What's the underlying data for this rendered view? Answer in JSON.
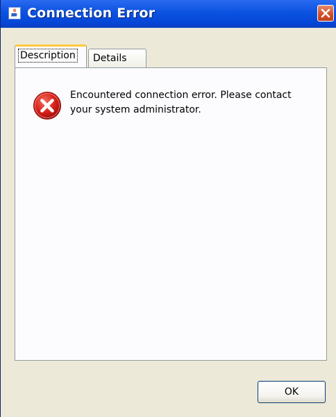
{
  "window": {
    "title": "Connection Error",
    "icon": "java-cup-icon",
    "close_icon": "close-icon"
  },
  "tabs": [
    {
      "label": "Description",
      "active": true
    },
    {
      "label": "Details",
      "active": false
    }
  ],
  "content": {
    "icon": "error-icon",
    "message": "Encountered connection error. Please contact your system administrator."
  },
  "buttons": {
    "ok_label": "OK"
  },
  "colors": {
    "titlebar": "#0a52e0",
    "close_button": "#d4502a",
    "active_tab_highlight": "#ffc83c",
    "error_red": "#d8201a"
  }
}
